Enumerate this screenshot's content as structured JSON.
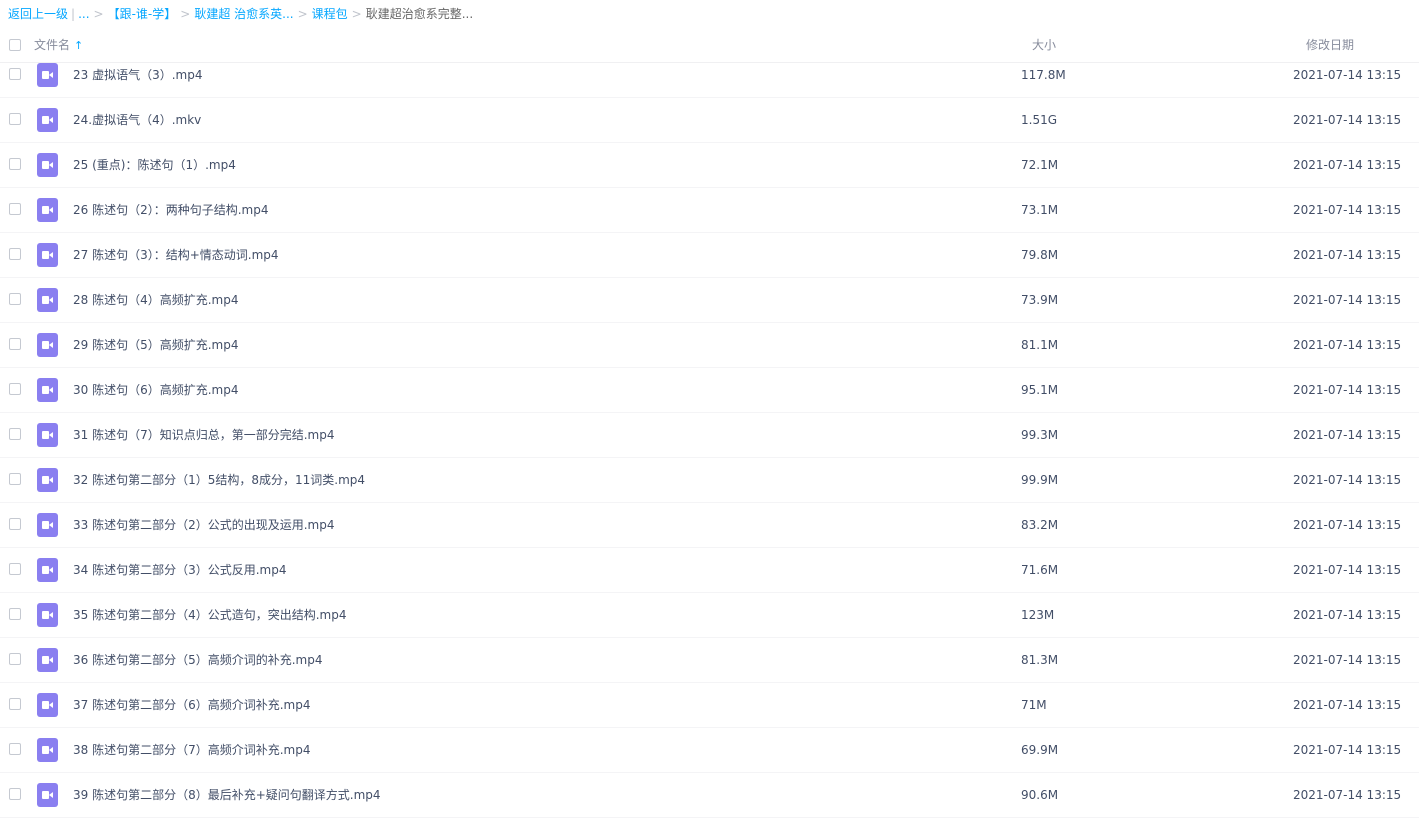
{
  "breadcrumb": {
    "back": "返回上一级",
    "ellipsis": "...",
    "items": [
      "【跟-谁-学】",
      "耿建超 治愈系英...",
      "课程包"
    ],
    "current": "耿建超治愈系完整..."
  },
  "header": {
    "name_label": "文件名",
    "sort_icon": "↑",
    "size_label": "大小",
    "date_label": "修改日期"
  },
  "files": [
    {
      "name": "23 虚拟语气（3）.mp4",
      "size": "117.8M",
      "date": "2021-07-14 13:15"
    },
    {
      "name": "24.虚拟语气（4）.mkv",
      "size": "1.51G",
      "date": "2021-07-14 13:15"
    },
    {
      "name": "25 (重点)：陈述句（1）.mp4",
      "size": "72.1M",
      "date": "2021-07-14 13:15"
    },
    {
      "name": "26 陈述句（2）：两种句子结构.mp4",
      "size": "73.1M",
      "date": "2021-07-14 13:15"
    },
    {
      "name": "27 陈述句（3）：结构+情态动词.mp4",
      "size": "79.8M",
      "date": "2021-07-14 13:15"
    },
    {
      "name": "28 陈述句（4）高频扩充.mp4",
      "size": "73.9M",
      "date": "2021-07-14 13:15"
    },
    {
      "name": "29 陈述句（5）高频扩充.mp4",
      "size": "81.1M",
      "date": "2021-07-14 13:15"
    },
    {
      "name": "30 陈述句（6）高频扩充.mp4",
      "size": "95.1M",
      "date": "2021-07-14 13:15"
    },
    {
      "name": "31 陈述句（7）知识点归总，第一部分完结.mp4",
      "size": "99.3M",
      "date": "2021-07-14 13:15"
    },
    {
      "name": "32 陈述句第二部分（1）5结构，8成分，11词类.mp4",
      "size": "99.9M",
      "date": "2021-07-14 13:15"
    },
    {
      "name": "33 陈述句第二部分（2）公式的出现及运用.mp4",
      "size": "83.2M",
      "date": "2021-07-14 13:15"
    },
    {
      "name": "34 陈述句第二部分（3）公式反用.mp4",
      "size": "71.6M",
      "date": "2021-07-14 13:15"
    },
    {
      "name": "35 陈述句第二部分（4）公式造句，突出结构.mp4",
      "size": "123M",
      "date": "2021-07-14 13:15"
    },
    {
      "name": "36 陈述句第二部分（5）高频介词的补充.mp4",
      "size": "81.3M",
      "date": "2021-07-14 13:15"
    },
    {
      "name": "37 陈述句第二部分（6）高频介词补充.mp4",
      "size": "71M",
      "date": "2021-07-14 13:15"
    },
    {
      "name": "38 陈述句第二部分（7）高频介词补充.mp4",
      "size": "69.9M",
      "date": "2021-07-14 13:15"
    },
    {
      "name": "39 陈述句第二部分（8）最后补充+疑问句翻译方式.mp4",
      "size": "90.6M",
      "date": "2021-07-14 13:15"
    }
  ],
  "icons": {
    "file_type": "video-file-icon",
    "accent_color": "#06a7ff",
    "video_icon_color": "#8a7ff0"
  }
}
